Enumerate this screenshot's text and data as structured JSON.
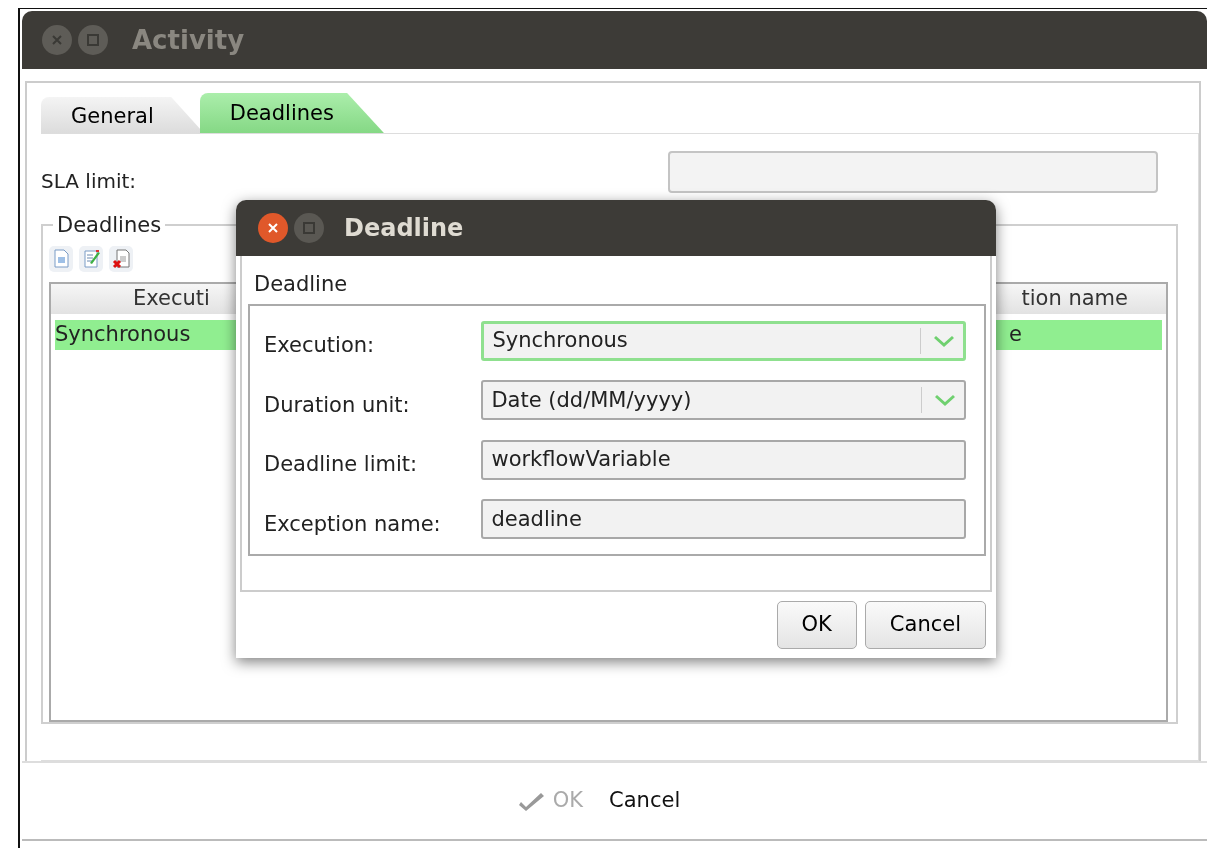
{
  "window": {
    "title": "Activity"
  },
  "tabs": [
    {
      "label": "General",
      "selected": false
    },
    {
      "label": "Deadlines",
      "selected": true
    }
  ],
  "sla_limit": {
    "label": "SLA limit:"
  },
  "deadlines_group": {
    "title": "Deadlines",
    "toolbar": [
      {
        "kind": "new"
      },
      {
        "kind": "edit"
      },
      {
        "kind": "delete"
      }
    ],
    "table": {
      "columns": [
        "Executi",
        "tion name"
      ],
      "rows": [
        {
          "cells": [
            "Synchronous",
            "e"
          ],
          "selected": true
        }
      ]
    }
  },
  "footer": {
    "buttons": [
      {
        "label": "OK",
        "disabled": true,
        "kind": "confirm"
      },
      {
        "label": "Cancel",
        "disabled": false,
        "kind": "plain"
      }
    ]
  },
  "dialog": {
    "title": "Deadline",
    "group_label": "Deadline",
    "fields": [
      {
        "label": "Execution:",
        "kind": "combo",
        "value": "Synchronous",
        "focused": true
      },
      {
        "label": "Duration unit:",
        "kind": "combo",
        "value": "Date (dd/MM/yyyy)",
        "focused": false
      },
      {
        "label": "Deadline limit:",
        "kind": "text",
        "value": "workflowVariable",
        "focused": false
      },
      {
        "label": "Exception name:",
        "kind": "text",
        "value": "deadline",
        "focused": false
      }
    ],
    "buttons": [
      {
        "label": "OK"
      },
      {
        "label": "Cancel"
      }
    ]
  }
}
